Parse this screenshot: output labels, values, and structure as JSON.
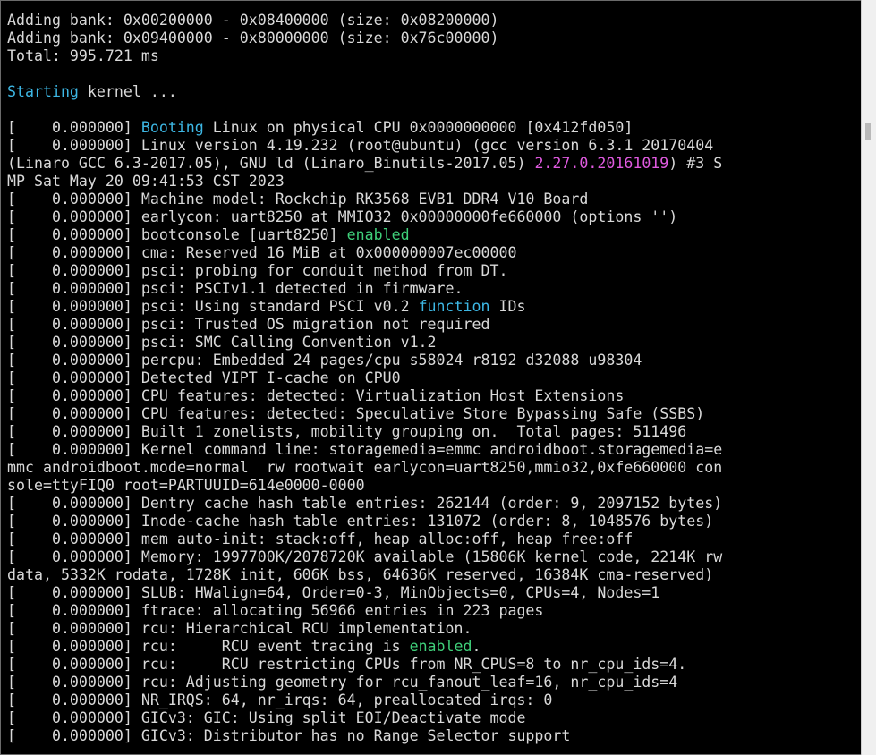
{
  "terminal": {
    "colors": {
      "default": "#d9d9d9",
      "cyan": "#3db7e4",
      "green": "#3fd07a",
      "magenta": "#e05ae0",
      "background": "#000000"
    },
    "lines": [
      [
        {
          "t": "Adding bank: 0x00200000 - 0x08400000 (size: 0x08200000)",
          "c": "default"
        }
      ],
      [
        {
          "t": "Adding bank: 0x09400000 - 0x80000000 (size: 0x76c00000)",
          "c": "default"
        }
      ],
      [
        {
          "t": "Total: 995.721 ms",
          "c": "default"
        }
      ],
      [
        {
          "t": "",
          "c": "default"
        }
      ],
      [
        {
          "t": "Starting",
          "c": "cyan"
        },
        {
          "t": " kernel ...",
          "c": "default"
        }
      ],
      [
        {
          "t": "",
          "c": "default"
        }
      ],
      [
        {
          "t": "[    0.000000] ",
          "c": "default"
        },
        {
          "t": "Booting",
          "c": "cyan"
        },
        {
          "t": " Linux on physical CPU 0x0000000000 [0x412fd050]",
          "c": "default"
        }
      ],
      [
        {
          "t": "[    0.000000] Linux version 4.19.232 (root@ubuntu) (gcc version 6.3.1 20170404",
          "c": "default"
        }
      ],
      [
        {
          "t": "(Linaro GCC 6.3-2017.05), GNU ld (Linaro_Binutils-2017.05) ",
          "c": "default"
        },
        {
          "t": "2.27.0.20161019",
          "c": "magenta"
        },
        {
          "t": ") #3 S",
          "c": "default"
        }
      ],
      [
        {
          "t": "MP Sat May 20 09:41:53 CST 2023",
          "c": "default"
        }
      ],
      [
        {
          "t": "[    0.000000] Machine model: Rockchip RK3568 EVB1 DDR4 V10 Board",
          "c": "default"
        }
      ],
      [
        {
          "t": "[    0.000000] earlycon: uart8250 at MMIO32 0x00000000fe660000 (options '')",
          "c": "default"
        }
      ],
      [
        {
          "t": "[    0.000000] bootconsole [uart8250] ",
          "c": "default"
        },
        {
          "t": "enabled",
          "c": "green"
        }
      ],
      [
        {
          "t": "[    0.000000] cma: Reserved 16 MiB at 0x000000007ec00000",
          "c": "default"
        }
      ],
      [
        {
          "t": "[    0.000000] psci: probing for conduit method from DT.",
          "c": "default"
        }
      ],
      [
        {
          "t": "[    0.000000] psci: PSCIv1.1 detected in firmware.",
          "c": "default"
        }
      ],
      [
        {
          "t": "[    0.000000] psci: Using standard PSCI v0.2 ",
          "c": "default"
        },
        {
          "t": "function",
          "c": "cyan"
        },
        {
          "t": " IDs",
          "c": "default"
        }
      ],
      [
        {
          "t": "[    0.000000] psci: Trusted OS migration not required",
          "c": "default"
        }
      ],
      [
        {
          "t": "[    0.000000] psci: SMC Calling Convention v1.2",
          "c": "default"
        }
      ],
      [
        {
          "t": "[    0.000000] percpu: Embedded 24 pages/cpu s58024 r8192 d32088 u98304",
          "c": "default"
        }
      ],
      [
        {
          "t": "[    0.000000] Detected VIPT I-cache on CPU0",
          "c": "default"
        }
      ],
      [
        {
          "t": "[    0.000000] CPU features: detected: Virtualization Host Extensions",
          "c": "default"
        }
      ],
      [
        {
          "t": "[    0.000000] CPU features: detected: Speculative Store Bypassing Safe (SSBS)",
          "c": "default"
        }
      ],
      [
        {
          "t": "[    0.000000] Built 1 zonelists, mobility grouping on.  Total pages: 511496",
          "c": "default"
        }
      ],
      [
        {
          "t": "[    0.000000] Kernel command line: storagemedia=emmc androidboot.storagemedia=e",
          "c": "default"
        }
      ],
      [
        {
          "t": "mmc androidboot.mode=normal  rw rootwait earlycon=uart8250,mmio32,0xfe660000 con",
          "c": "default"
        }
      ],
      [
        {
          "t": "sole=ttyFIQ0 root=PARTUUID=614e0000-0000",
          "c": "default"
        }
      ],
      [
        {
          "t": "[    0.000000] Dentry cache hash table entries: 262144 (order: 9, 2097152 bytes)",
          "c": "default"
        }
      ],
      [
        {
          "t": "[    0.000000] Inode-cache hash table entries: 131072 (order: 8, 1048576 bytes)",
          "c": "default"
        }
      ],
      [
        {
          "t": "[    0.000000] mem auto-init: stack:off, heap alloc:off, heap free:off",
          "c": "default"
        }
      ],
      [
        {
          "t": "[    0.000000] Memory: 1997700K/2078720K available (15806K kernel code, 2214K rw",
          "c": "default"
        }
      ],
      [
        {
          "t": "data, 5332K rodata, 1728K init, 606K bss, 64636K reserved, 16384K cma-reserved)",
          "c": "default"
        }
      ],
      [
        {
          "t": "[    0.000000] SLUB: HWalign=64, Order=0-3, MinObjects=0, CPUs=4, Nodes=1",
          "c": "default"
        }
      ],
      [
        {
          "t": "[    0.000000] ftrace: allocating 56966 entries in 223 pages",
          "c": "default"
        }
      ],
      [
        {
          "t": "[    0.000000] rcu: Hierarchical RCU implementation.",
          "c": "default"
        }
      ],
      [
        {
          "t": "[    0.000000] rcu:     RCU event tracing is ",
          "c": "default"
        },
        {
          "t": "enabled",
          "c": "green"
        },
        {
          "t": ".",
          "c": "default"
        }
      ],
      [
        {
          "t": "[    0.000000] rcu:     RCU restricting CPUs from NR_CPUS=8 to nr_cpu_ids=4.",
          "c": "default"
        }
      ],
      [
        {
          "t": "[    0.000000] rcu: Adjusting geometry for rcu_fanout_leaf=16, nr_cpu_ids=4",
          "c": "default"
        }
      ],
      [
        {
          "t": "[    0.000000] NR_IRQS: 64, nr_irqs: 64, preallocated irqs: 0",
          "c": "default"
        }
      ],
      [
        {
          "t": "[    0.000000] GICv3: GIC: Using split EOI/Deactivate mode",
          "c": "default"
        }
      ],
      [
        {
          "t": "[    0.000000] GICv3: Distributor has no Range Selector support",
          "c": "default"
        }
      ]
    ]
  }
}
